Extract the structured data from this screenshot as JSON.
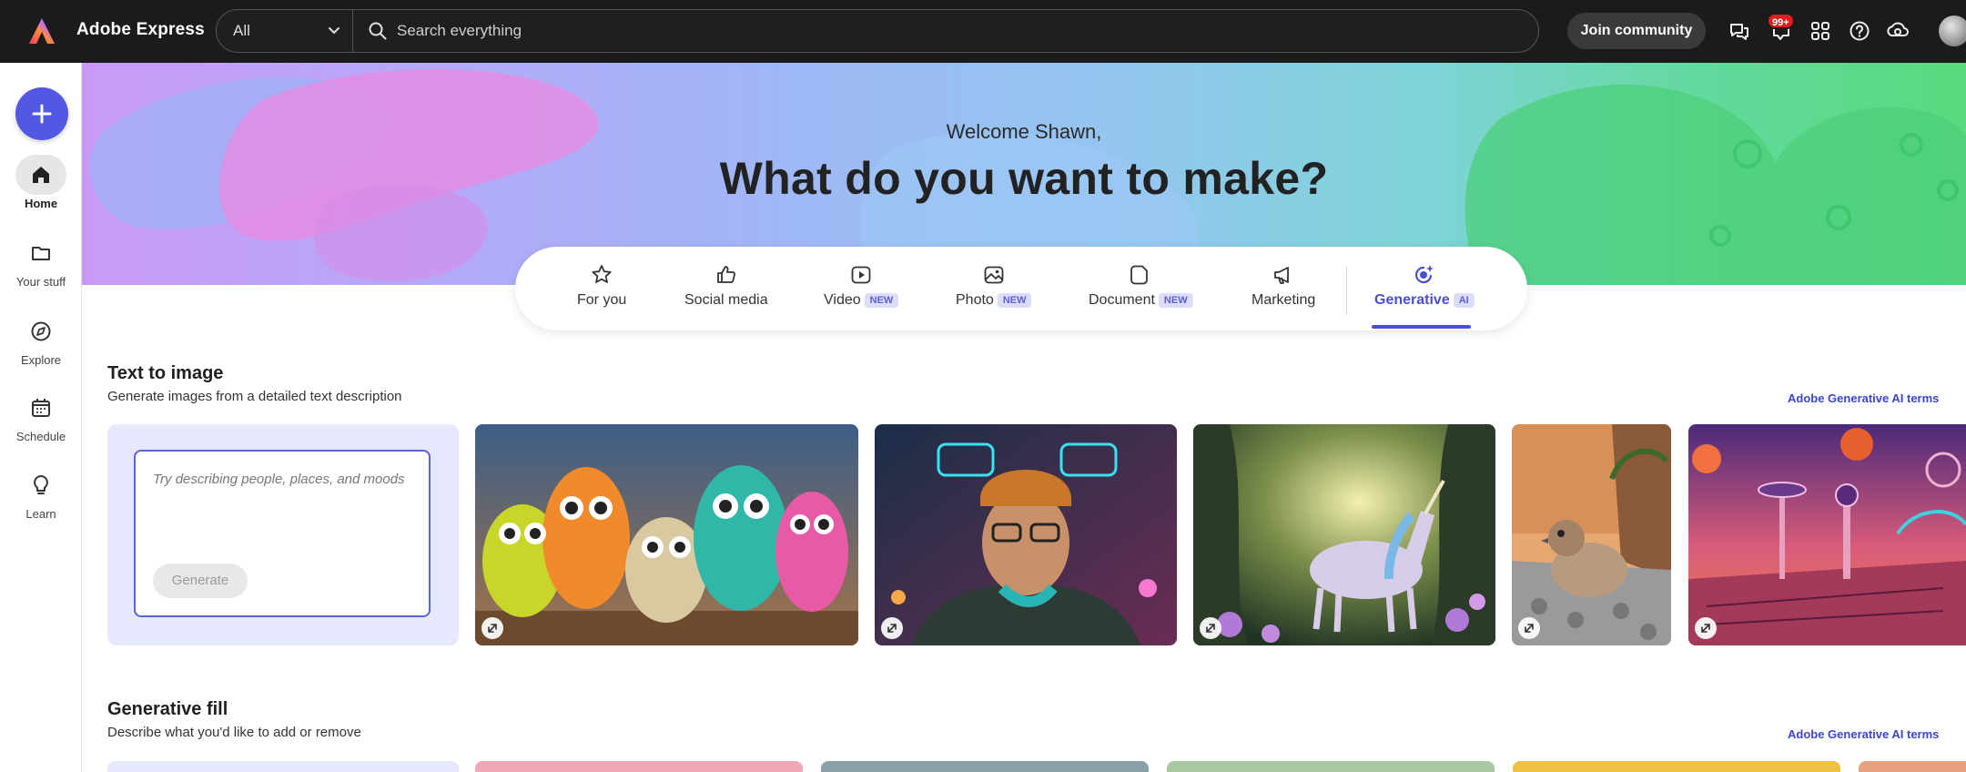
{
  "app": {
    "name": "Adobe Express"
  },
  "topbar": {
    "scope_value": "All",
    "search_placeholder": "Search everything",
    "join_label": "Join community",
    "notification_count": "99+"
  },
  "rail": {
    "items": [
      {
        "label": "Home",
        "icon": "home-icon"
      },
      {
        "label": "Your stuff",
        "icon": "folder-icon"
      },
      {
        "label": "Explore",
        "icon": "compass-icon"
      },
      {
        "label": "Schedule",
        "icon": "calendar-icon"
      },
      {
        "label": "Learn",
        "icon": "lightbulb-icon"
      }
    ]
  },
  "hero": {
    "welcome": "Welcome Shawn,",
    "title": "What do you want to make?"
  },
  "tabs": [
    {
      "label": "For you",
      "icon": "star-icon"
    },
    {
      "label": "Social media",
      "icon": "thumbs-up-icon"
    },
    {
      "label": "Video",
      "badge": "NEW",
      "icon": "video-icon"
    },
    {
      "label": "Photo",
      "badge": "NEW",
      "icon": "photo-icon"
    },
    {
      "label": "Document",
      "badge": "NEW",
      "icon": "document-icon"
    },
    {
      "label": "Marketing",
      "icon": "megaphone-icon"
    },
    {
      "label": "Generative",
      "badge": "AI",
      "icon": "generative-icon",
      "active": true
    }
  ],
  "sections": {
    "text_to_image": {
      "title": "Text to image",
      "subtitle": "Generate images from a detailed text description",
      "terms_link": "Adobe Generative AI terms",
      "prompt_placeholder": "Try describing people, places, and moods",
      "generate_label": "Generate"
    },
    "generative_fill": {
      "title": "Generative fill",
      "subtitle": "Describe what you'd like to add or remove",
      "terms_link": "Adobe Generative AI terms"
    }
  },
  "colors": {
    "accent": "#4a4fd0",
    "create_button": "#5258e4",
    "topbar": "#1b1b1b",
    "prompt_card": "#e6e8fd"
  }
}
